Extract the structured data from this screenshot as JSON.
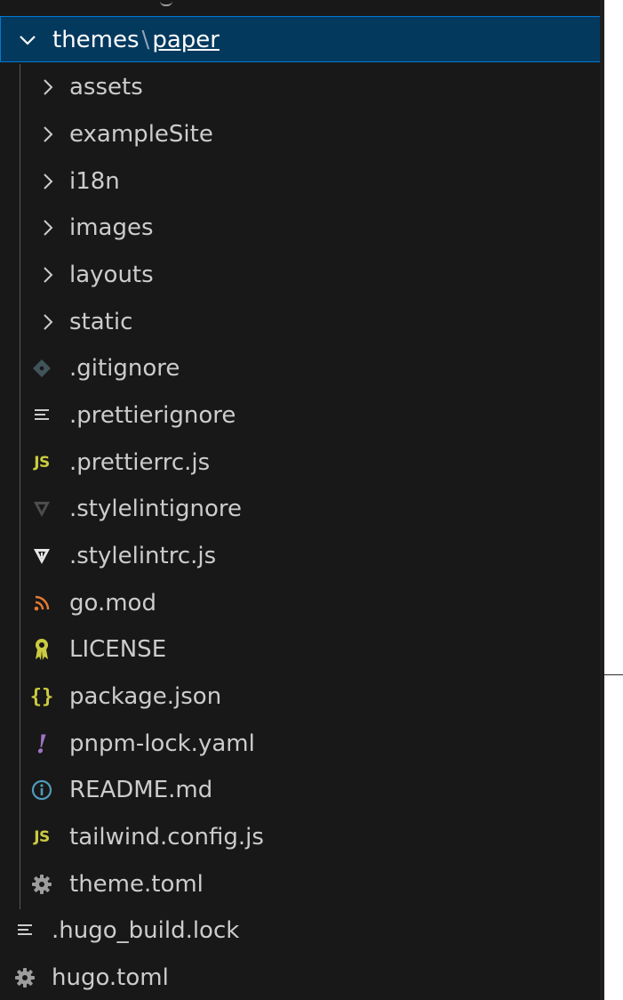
{
  "explorer": {
    "folder": {
      "parent": "themes",
      "separator": "\\",
      "name": "paper",
      "expanded": true
    },
    "children": [
      {
        "label": "assets",
        "kind": "folder",
        "icon": "chevron-right-icon"
      },
      {
        "label": "exampleSite",
        "kind": "folder",
        "icon": "chevron-right-icon"
      },
      {
        "label": "i18n",
        "kind": "folder",
        "icon": "chevron-right-icon"
      },
      {
        "label": "images",
        "kind": "folder",
        "icon": "chevron-right-icon"
      },
      {
        "label": "layouts",
        "kind": "folder",
        "icon": "chevron-right-icon"
      },
      {
        "label": "static",
        "kind": "folder",
        "icon": "chevron-right-icon"
      },
      {
        "label": ".gitignore",
        "kind": "file",
        "icon": "git-icon"
      },
      {
        "label": ".prettierignore",
        "kind": "file",
        "icon": "lines-icon"
      },
      {
        "label": ".prettierrc.js",
        "kind": "file",
        "icon": "js-icon",
        "badge": "JS"
      },
      {
        "label": ".stylelintignore",
        "kind": "file",
        "icon": "stylelint-dim-icon"
      },
      {
        "label": ".stylelintrc.js",
        "kind": "file",
        "icon": "stylelint-icon"
      },
      {
        "label": "go.mod",
        "kind": "file",
        "icon": "rss-icon"
      },
      {
        "label": "LICENSE",
        "kind": "file",
        "icon": "license-icon"
      },
      {
        "label": "package.json",
        "kind": "file",
        "icon": "json-braces-icon",
        "badge": "{}"
      },
      {
        "label": "pnpm-lock.yaml",
        "kind": "file",
        "icon": "yaml-exclamation-icon",
        "badge": "!"
      },
      {
        "label": "README.md",
        "kind": "file",
        "icon": "info-icon"
      },
      {
        "label": "tailwind.config.js",
        "kind": "file",
        "icon": "js-icon",
        "badge": "JS"
      },
      {
        "label": "theme.toml",
        "kind": "file",
        "icon": "gear-icon"
      }
    ],
    "root_files": [
      {
        "label": ".hugo_build.lock",
        "kind": "file",
        "icon": "lines-icon"
      },
      {
        "label": "hugo.toml",
        "kind": "file",
        "icon": "gear-icon"
      }
    ]
  },
  "colors": {
    "background": "#181818",
    "selected_background": "#04395e",
    "selected_border": "#0078d4",
    "text": "#cccccc",
    "js_yellow": "#cbcb41",
    "rss_orange": "#e37933",
    "yaml_purple": "#a074c4",
    "license_yellow": "#cbcb41",
    "info_blue": "#519aba",
    "icon_grey": "#9d9d9d"
  }
}
